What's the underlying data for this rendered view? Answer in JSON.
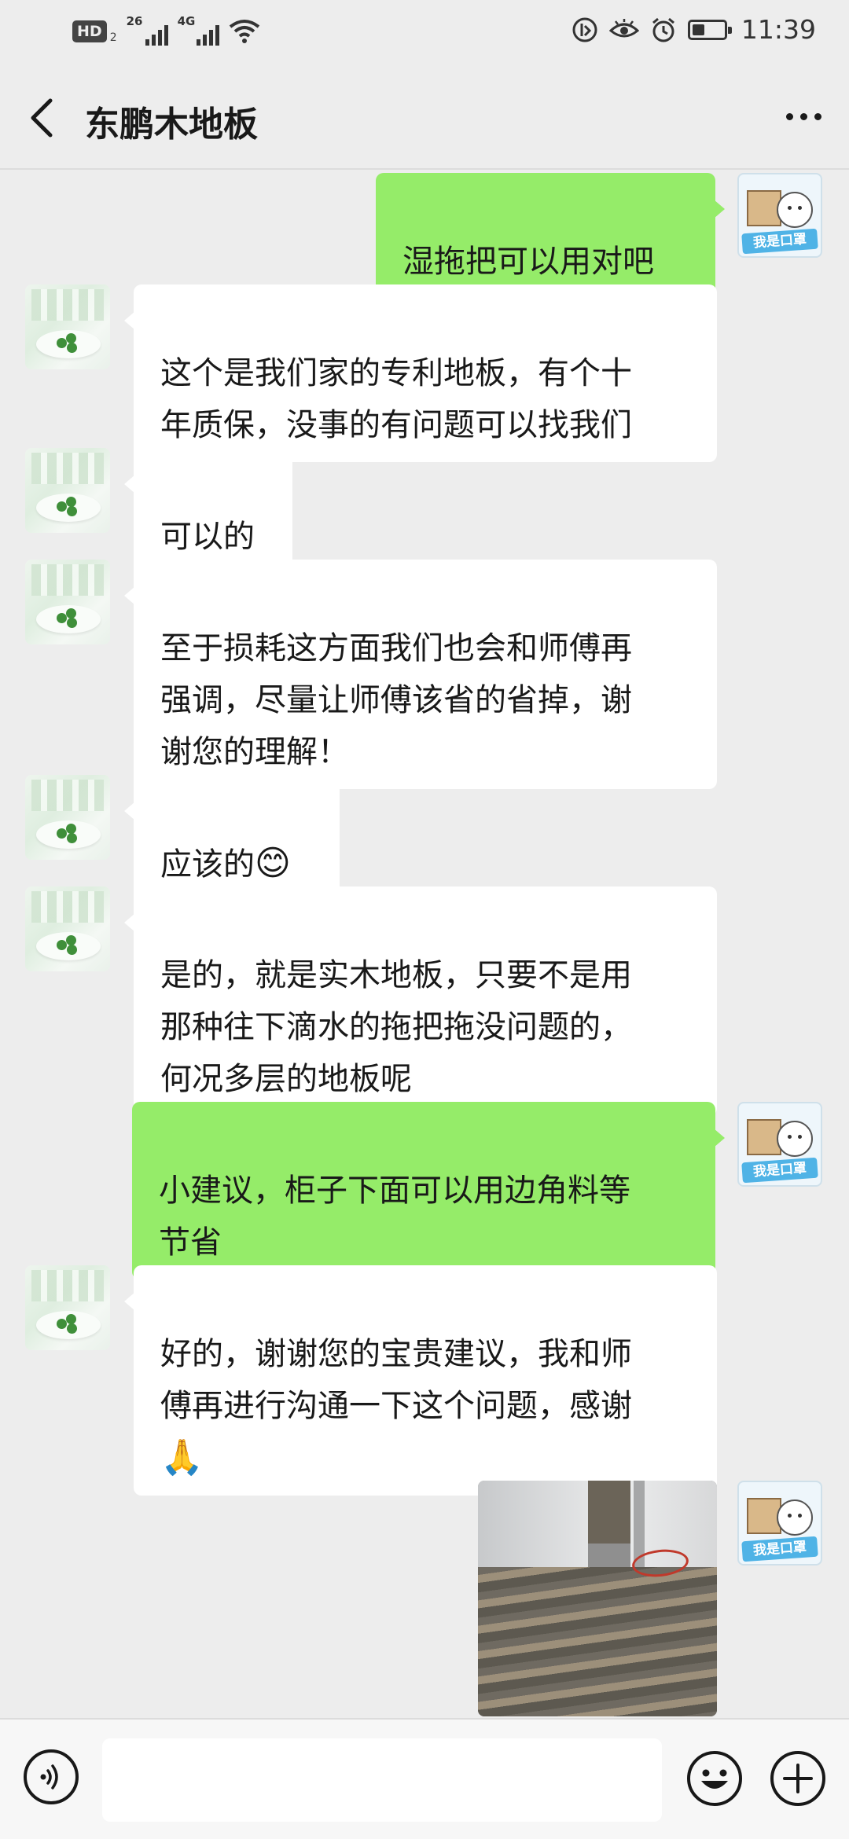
{
  "status_bar": {
    "hd_label": "HD",
    "hd_sub": "2",
    "sim1_tag": "26",
    "sim2_tag": "4G",
    "battery_level": 0.4,
    "time": "11:39"
  },
  "header": {
    "title": "东鹏木地板"
  },
  "messages": [
    {
      "side": "right",
      "text": "湿拖把可以用对吧"
    },
    {
      "side": "left",
      "text": "这个是我们家的专利地板，有个十\n年质保，没事的有问题可以找我们"
    },
    {
      "side": "left",
      "text": "可以的"
    },
    {
      "side": "left",
      "text": "至于损耗这方面我们也会和师傅再\n强调，尽量让师傅该省的省掉，谢\n谢您的理解！"
    },
    {
      "side": "left",
      "text": "应该的",
      "emoji": "😊"
    },
    {
      "side": "left",
      "text": "是的，就是实木地板，只要不是用\n那种往下滴水的拖把拖没问题的，\n何况多层的地板呢"
    },
    {
      "side": "right",
      "text": "小建议，柜子下面可以用边角料等\n节省"
    },
    {
      "side": "left",
      "text": "好的，谢谢您的宝贵建议，我和师\n傅再进行沟通一下这个问题，感谢\n",
      "emoji": "🙏"
    },
    {
      "side": "right",
      "type": "image"
    }
  ],
  "avatars": {
    "self_tag": "我是口罩"
  },
  "input_bar": {
    "placeholder": ""
  }
}
